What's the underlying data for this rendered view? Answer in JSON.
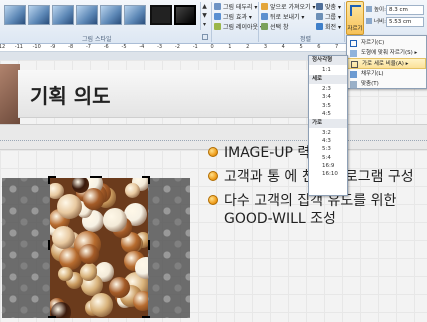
{
  "ribbon": {
    "picture_styles_group_label": "그림 스타일",
    "arrange_group_label": "정렬",
    "commands": {
      "picture_border": "그림 테두리",
      "picture_effects": "그림 효과",
      "picture_layout": "그림 레이아웃",
      "bring_forward": "앞으로 가져오기",
      "send_backward": "뒤로 보내기",
      "selection_pane": "선택 창",
      "align": "맞춤",
      "group": "그룹",
      "rotate": "회전"
    },
    "crop_label": "자르기",
    "height_label": "높이:",
    "height_value": "8.3 cm",
    "width_label": "너비:",
    "width_value": "5.53 cm"
  },
  "crop_menu": {
    "items": [
      {
        "label": "자르기(C)"
      },
      {
        "label": "도형에 맞춰 자르기(S)"
      },
      {
        "label": "가로 세로 비율(A)"
      },
      {
        "label": "채우기(L)"
      },
      {
        "label": "맞춤(T)"
      }
    ]
  },
  "ratio_menu": {
    "square_header": "정사각형",
    "square_items": [
      "1:1"
    ],
    "portrait_header": "세로",
    "portrait_items": [
      "2:3",
      "3:4",
      "3:5",
      "4:5"
    ],
    "landscape_header": "가로",
    "landscape_items": [
      "3:2",
      "4:3",
      "5:3",
      "5:4",
      "16:9",
      "16:10"
    ]
  },
  "slide": {
    "title": "기획 의도",
    "bullets": [
      "IMAGE-UP      력",
      "고객과 통      에 친화 프로그램 구성",
      "다수 고객의 집객 유도를 위한 GOOD-WILL 조성"
    ]
  },
  "ruler": {
    "marks": [
      "-12",
      "-11",
      "-10",
      "-9",
      "-8",
      "-7",
      "-6",
      "-5",
      "-4",
      "-3",
      "-2",
      "-1",
      "0",
      "1",
      "2",
      "3",
      "4",
      "5",
      "6",
      "7",
      "8",
      "9",
      "10",
      "11",
      "12"
    ]
  }
}
